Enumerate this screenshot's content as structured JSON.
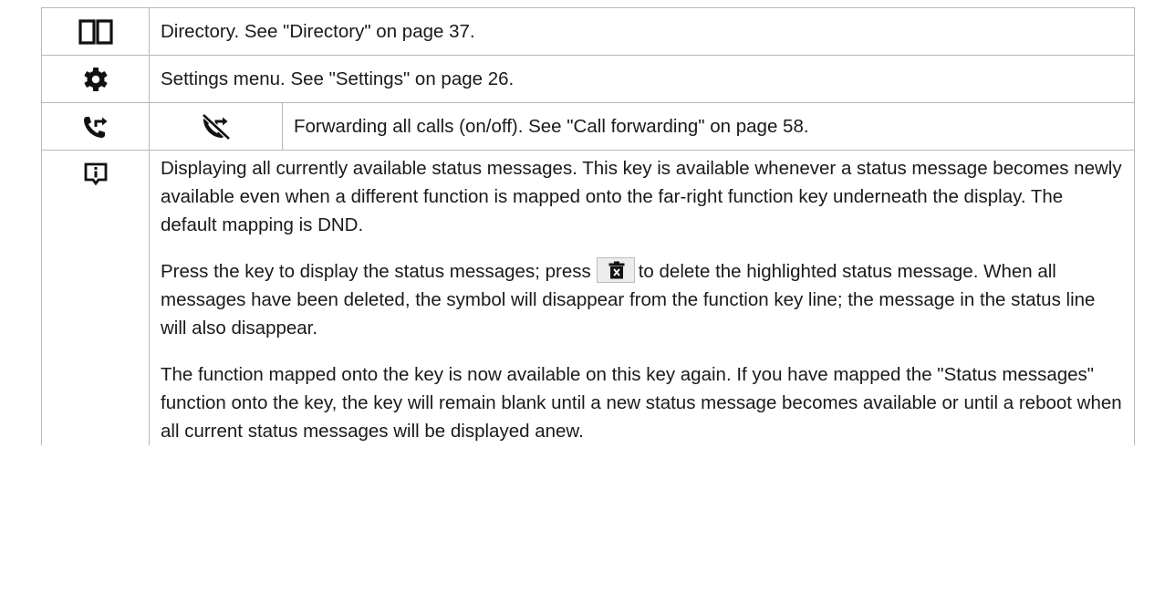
{
  "rows": [
    {
      "icon": "book-icon",
      "text": "Directory.  See \"Directory\" on page 37."
    },
    {
      "icon": "gear-icon",
      "text": "Settings menu.  See \"Settings\" on page 26."
    },
    {
      "icon": "call-forward-icon",
      "icon2": "call-forward-off-icon",
      "text": "Forwarding all calls (on/off).  See \"Call forwarding\" on page 58."
    },
    {
      "icon": "status-info-icon",
      "para1": "Displaying all currently available status messages.  This key is available whenever a status message becomes newly available even when a different function is mapped onto the far-right function key underneath the display.  The default mapping is DND.",
      "para2_before": "Press the key to display the status messages;  press",
      "inline_icon": "trash-delete-icon",
      "para2_after": "to delete the highlighted status message.  When all messages have been deleted, the symbol will disappear from the function key line; the message in the status line will also disappear.",
      "para3": "The function mapped onto the key is now available on this key again.  If you have mapped the \"Status messages\" function onto the key, the key will remain blank until a new status message becomes available or until a reboot when all current status messages will be displayed anew."
    }
  ]
}
